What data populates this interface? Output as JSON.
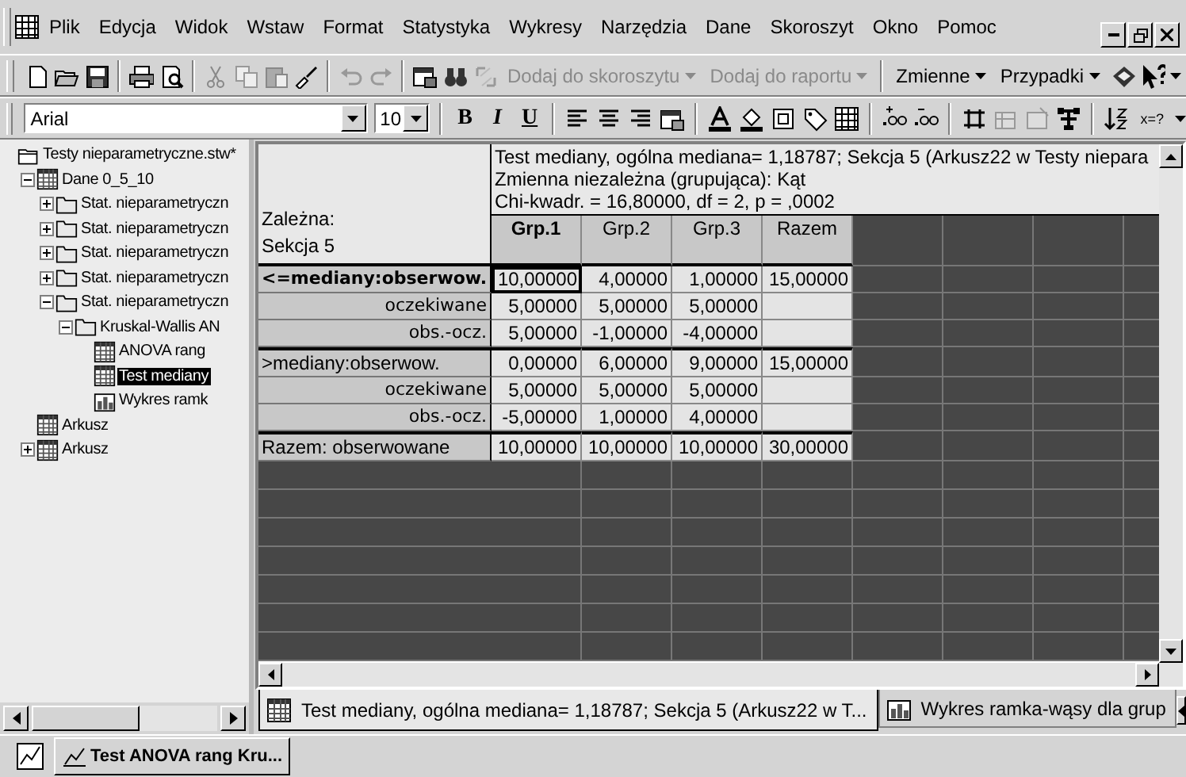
{
  "menu": [
    "Plik",
    "Edycja",
    "Widok",
    "Wstaw",
    "Format",
    "Statystyka",
    "Wykresy",
    "Narzędzia",
    "Dane",
    "Skoroszyt",
    "Okno",
    "Pomoc"
  ],
  "toolbar": {
    "actions": [
      {
        "label": "Dodaj do skoroszytu",
        "disabled": true
      },
      {
        "label": "Dodaj do raportu",
        "disabled": true
      },
      {
        "label": "Zmienne",
        "disabled": false
      },
      {
        "label": "Przypadki",
        "disabled": false
      }
    ]
  },
  "format_bar": {
    "font": "Arial",
    "size": "10",
    "styles": [
      {
        "label": "B",
        "kind": "bold"
      },
      {
        "label": "I",
        "kind": "italic"
      },
      {
        "label": "U",
        "kind": "underline"
      }
    ],
    "formula": "x=?"
  },
  "tree": [
    {
      "label": "Testy nieparametryczne.stw*",
      "kind": "workbook",
      "children": [
        {
          "label": "Dane 0_5_10",
          "kind": "sheet",
          "expanded": true,
          "selected": false,
          "children": [
            {
              "label": "Stat. nieparametryczn",
              "kind": "folder",
              "expanded": false,
              "selected": false
            },
            {
              "label": "Stat. nieparametryczn",
              "kind": "folder",
              "expanded": false,
              "selected": false
            },
            {
              "label": "Stat. nieparametryczn",
              "kind": "folder",
              "expanded": false,
              "selected": false
            },
            {
              "label": "Stat. nieparametryczn",
              "kind": "folder",
              "expanded": false,
              "selected": false
            },
            {
              "label": "Stat. nieparametryczn",
              "kind": "folder",
              "expanded": true,
              "selected": false,
              "children": [
                {
                  "label": "Kruskal-Wallis AN",
                  "kind": "folder",
                  "expanded": true,
                  "selected": false,
                  "children": [
                    {
                      "label": "ANOVA rang",
                      "kind": "sheet",
                      "selected": false
                    },
                    {
                      "label": "Test mediany",
                      "kind": "sheet",
                      "selected": true
                    },
                    {
                      "label": "Wykres ramk",
                      "kind": "graph",
                      "selected": false
                    }
                  ]
                }
              ]
            }
          ]
        },
        {
          "label": "Arkusz",
          "kind": "sheet",
          "selected": false
        },
        {
          "label": "Arkusz",
          "kind": "sheet",
          "expanded": false,
          "selected": false
        }
      ]
    }
  ],
  "sheet": {
    "title_lines": [
      "Test mediany, ogólna mediana= 1,18787; Sekcja 5 (Arkusz22 w Testy niepara",
      "Zmienna niezależna (grupująca): Kąt",
      "Chi-kwadr. = 16,80000, df = 2, p = ,0002"
    ],
    "corner": [
      "Zależna:",
      "Sekcja 5"
    ],
    "columns": [
      {
        "label": "Grp.1",
        "selected": true
      },
      {
        "label": "Grp.2",
        "selected": false
      },
      {
        "label": "Grp.3",
        "selected": false
      },
      {
        "label": "Razem",
        "selected": false
      }
    ],
    "rows": [
      {
        "label": "<=mediany:obserwow.",
        "kind": "group",
        "selected": true,
        "cells": [
          "10,00000",
          "4,00000",
          "1,00000",
          "15,00000"
        ]
      },
      {
        "label": "oczekiwane",
        "kind": "sub",
        "selected": false,
        "cells": [
          "5,00000",
          "5,00000",
          "5,00000"
        ]
      },
      {
        "label": "obs.-ocz.",
        "kind": "sub",
        "selected": false,
        "cells": [
          "5,00000",
          "-1,00000",
          "-4,00000"
        ]
      },
      {
        "label": ">mediany:obserwow.",
        "kind": "group",
        "selected": false,
        "cells": [
          "0,00000",
          "6,00000",
          "9,00000",
          "15,00000"
        ]
      },
      {
        "label": "oczekiwane",
        "kind": "sub",
        "selected": false,
        "cells": [
          "5,00000",
          "5,00000",
          "5,00000"
        ]
      },
      {
        "label": "obs.-ocz.",
        "kind": "sub",
        "selected": false,
        "cells": [
          "-5,00000",
          "1,00000",
          "4,00000"
        ]
      },
      {
        "label": "Razem: obserwowane",
        "kind": "group",
        "selected": false,
        "cells": [
          "10,00000",
          "10,00000",
          "10,00000",
          "30,00000"
        ]
      }
    ]
  },
  "sheet_tabs": [
    {
      "label": "Test mediany, ogólna mediana= 1,18787; Sekcja 5 (Arkusz22 w T...",
      "kind": "sheet",
      "selected": true
    },
    {
      "label": "Wykres ramka-wąsy dla grup",
      "kind": "graph",
      "selected": false
    }
  ],
  "taskbar": [
    {
      "label": "Test ANOVA rang Kru..."
    }
  ]
}
